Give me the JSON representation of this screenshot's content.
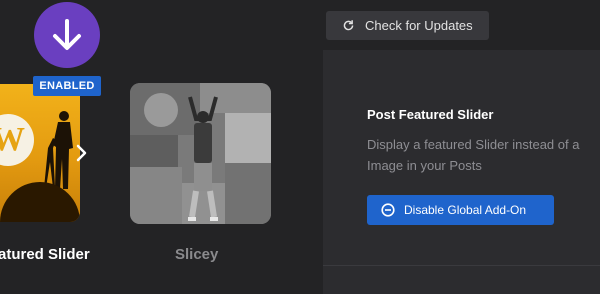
{
  "header": {
    "check_updates_label": "Check for Updates"
  },
  "addons": [
    {
      "name": "Featured Slider",
      "display_label": "atured Slider",
      "status_badge": "ENABLED",
      "active": true
    },
    {
      "name": "Slicey",
      "display_label": "Slicey",
      "active": false
    }
  ],
  "detail": {
    "title": "Post Featured Slider",
    "description": "Display a featured Slider instead of a Image in your Posts",
    "action_label": "Disable Global Add-On"
  },
  "icons": {
    "download": "arrow-down-icon",
    "refresh": "refresh-icon",
    "next": "chevron-right-icon",
    "disable": "minus-circle-icon"
  },
  "colors": {
    "accent_blue": "#1f64cc",
    "badge_purple": "#6a3fc0",
    "background": "#232325",
    "panel": "#2c2c2f"
  }
}
